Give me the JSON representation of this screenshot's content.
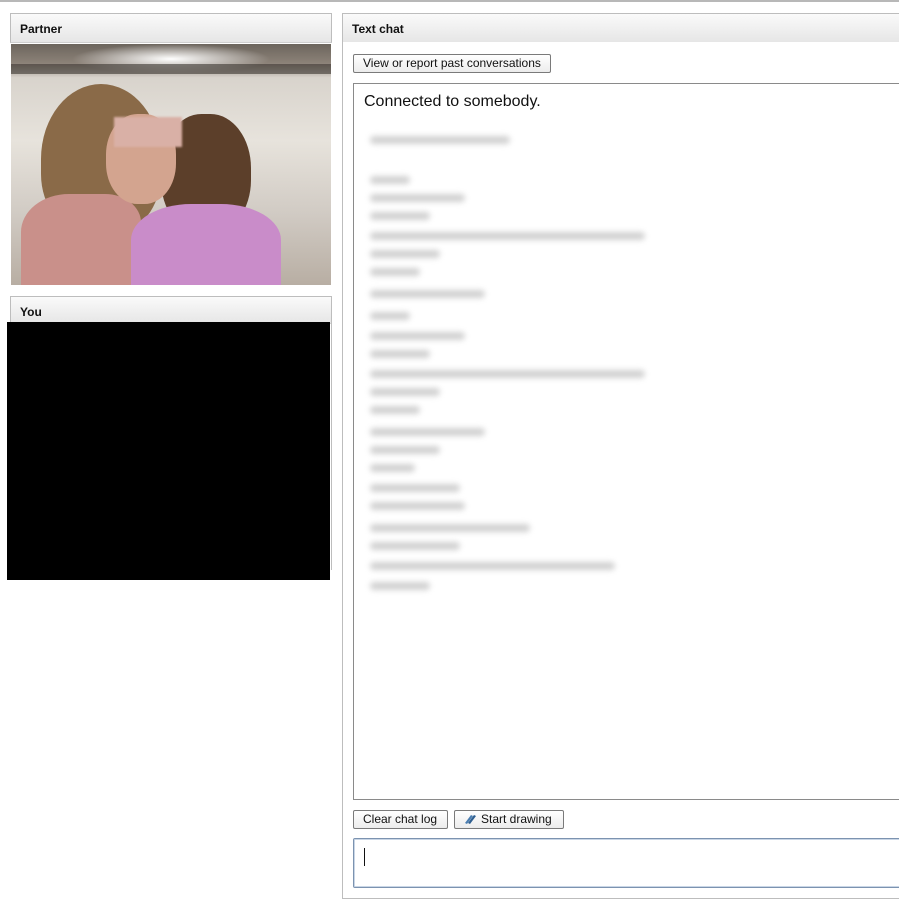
{
  "partner_panel": {
    "title": "Partner"
  },
  "you_panel": {
    "title": "You"
  },
  "chat_panel": {
    "title": "Text chat",
    "view_report_label": "View or report past conversations",
    "status_message": "Connected to somebody.",
    "clear_log_label": "Clear chat log",
    "start_drawing_label": "Start drawing",
    "start_drawing_icon": "pencil-icon",
    "message_input_value": ""
  }
}
